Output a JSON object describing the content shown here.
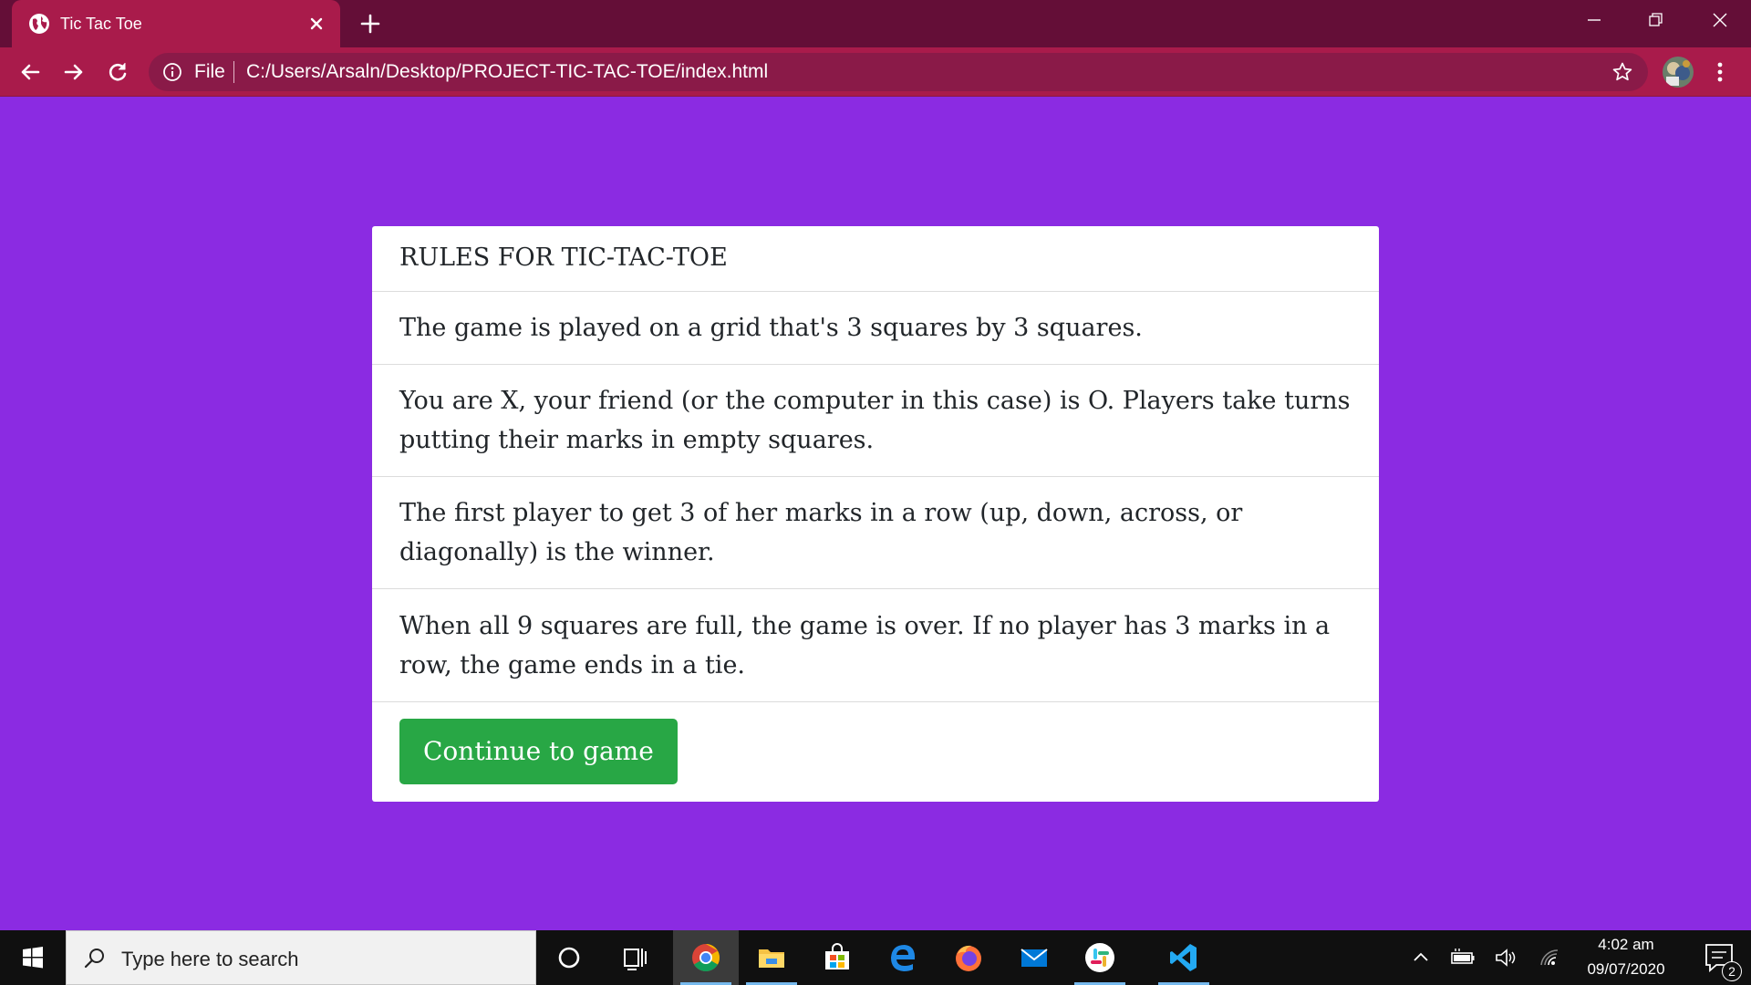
{
  "browser": {
    "tab_title": "Tic Tac Toe",
    "address": {
      "scheme_label": "File",
      "url": "C:/Users/Arsaln/Desktop/PROJECT-TIC-TAC-TOE/index.html"
    }
  },
  "page": {
    "background_color": "#8b2be2",
    "card": {
      "header": "RULES FOR TIC-TAC-TOE",
      "rules": [
        "The game is played on a grid that's 3 squares by 3 squares.",
        "You are X, your friend (or the computer in this case) is O. Players take turns putting their marks in empty squares.",
        "The first player to get 3 of her marks in a row (up, down, across, or diagonally) is the winner.",
        "When all 9 squares are full, the game is over. If no player has 3 marks in a row, the game ends in a tie."
      ],
      "continue_button": "Continue to game",
      "button_color": "#28a745"
    }
  },
  "taskbar": {
    "search_placeholder": "Type here to search",
    "pinned_apps": [
      "chrome-icon",
      "file-explorer-icon",
      "store-icon",
      "edge-icon",
      "firefox-icon",
      "mail-icon",
      "slack-icon",
      "vscode-icon"
    ],
    "clock": {
      "time": "4:02 am",
      "date": "09/07/2020"
    },
    "notification_count": "2"
  }
}
